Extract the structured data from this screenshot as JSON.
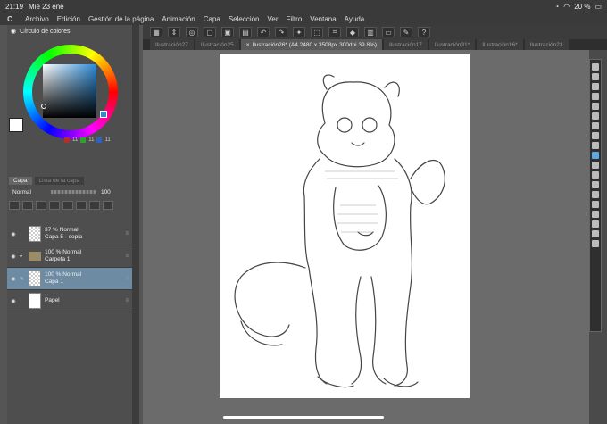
{
  "status": {
    "time": "21:19",
    "date": "Mié 23 ene",
    "battery": "20 %"
  },
  "menu": [
    "Archivo",
    "Edición",
    "Gestión de la página",
    "Animación",
    "Capa",
    "Selección",
    "Ver",
    "Filtro",
    "Ventana",
    "Ayuda"
  ],
  "tabs": [
    {
      "label": "Ilustración27"
    },
    {
      "label": "Ilustración25"
    },
    {
      "label": "Ilustración26* (A4 2480 x 3508px 300dpi 39.8%)",
      "active": true
    },
    {
      "label": "Ilustración17"
    },
    {
      "label": "Ilustración31*"
    },
    {
      "label": "Ilustración16*"
    },
    {
      "label": "Ilustración23"
    }
  ],
  "colorPanel": {
    "title": "Círculo de colores",
    "hue_color": "#2d8bd6",
    "mini_counts": [
      "11",
      "11",
      "11"
    ]
  },
  "layerPanel": {
    "tab_layer": "Capa",
    "tab_other": "Lista de la capa",
    "blend": "Normal",
    "opacity": "100",
    "layers": [
      {
        "line1": "37 % Normal",
        "line2": "Capa 5 - copia",
        "type": "raster"
      },
      {
        "line1": "100 % Normal",
        "line2": "Carpeta 1",
        "type": "folder"
      },
      {
        "line1": "100 % Normal",
        "line2": "Capa 1",
        "type": "raster",
        "selected": true
      },
      {
        "line1": "",
        "line2": "Papel",
        "type": "paper"
      }
    ]
  }
}
